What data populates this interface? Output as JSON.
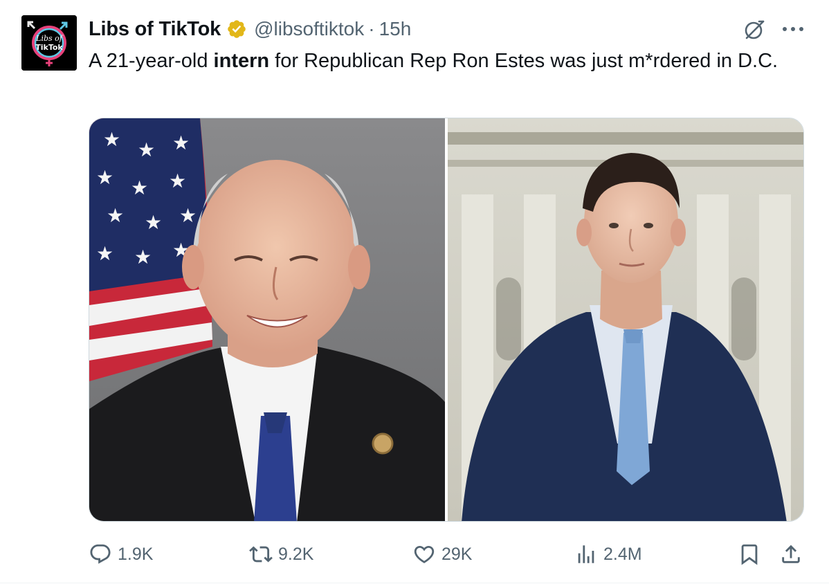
{
  "author": {
    "display_name": "Libs of TikTok",
    "handle": "@libsoftiktok",
    "separator": "·",
    "time": "15h",
    "avatar_text_line1": "Libs of",
    "avatar_text_line2": "TikTok",
    "verified_icon": "verified-badge-icon"
  },
  "tweet": {
    "text_before": "A 21-year-old ",
    "text_bold": "intern",
    "text_after": " for Republican Rep Ron Estes was just m*rdered in D.C."
  },
  "actions": {
    "replies": "1.9K",
    "reposts": "9.2K",
    "likes": "29K",
    "views": "2.4M"
  },
  "icons": {
    "reply": "speech-bubble-icon",
    "repost": "repost-arrows-icon",
    "like": "heart-icon",
    "views": "bar-chart-icon",
    "bookmark": "bookmark-icon",
    "share": "share-upload-icon",
    "grok": "grok-slash-circle-icon",
    "more": "more-dots-icon"
  },
  "colors": {
    "text_primary": "#0f1419",
    "text_secondary": "#536471",
    "verified_gold": "#e2b719",
    "border": "#cfd9de"
  }
}
